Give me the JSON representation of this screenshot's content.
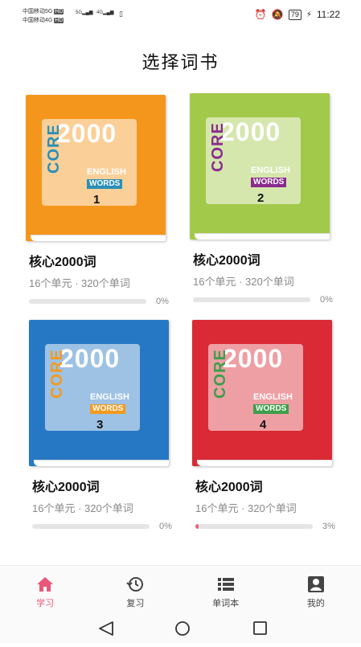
{
  "status_bar": {
    "carrier_line1": "中国移动5G",
    "carrier_line1_badge": "HD",
    "carrier_line2": "中国移动4G",
    "carrier_line2_badge": "HD",
    "net1": "5G",
    "net2": "4G",
    "battery": "79",
    "time": "11:22"
  },
  "title": "选择词书",
  "books": [
    {
      "title": "核心2000词",
      "meta": "16个单元 · 320个单词",
      "progress": 0,
      "progress_text": "0%",
      "cover_number": "2000",
      "cover_core": "CORE",
      "cover_english": "ENGLISH",
      "cover_words": "WORDS",
      "volume": "1",
      "color": "#f5961c",
      "core_color": "#2a8fb5",
      "words_bg": "#2a8fb5"
    },
    {
      "title": "核心2000词",
      "meta": "16个单元 · 320个单词",
      "progress": 0,
      "progress_text": "0%",
      "cover_number": "2000",
      "cover_core": "CORE",
      "cover_english": "ENGLISH",
      "cover_words": "WORDS",
      "volume": "2",
      "color": "#a3c94a",
      "core_color": "#8a2b8f",
      "words_bg": "#8a2b8f"
    },
    {
      "title": "核心2000词",
      "meta": "16个单元 · 320个单词",
      "progress": 0,
      "progress_text": "0%",
      "cover_number": "2000",
      "cover_core": "CORE",
      "cover_english": "ENGLISH",
      "cover_words": "WORDS",
      "volume": "3",
      "color": "#2778c4",
      "core_color": "#f39a1e",
      "words_bg": "#f39a1e"
    },
    {
      "title": "核心2000词",
      "meta": "16个单元 · 320个单词",
      "progress": 0.03,
      "progress_text": "3%",
      "cover_number": "2000",
      "cover_core": "CORE",
      "cover_english": "ENGLISH",
      "cover_words": "WORDS",
      "volume": "4",
      "color": "#d92a35",
      "core_color": "#3d9e4a",
      "words_bg": "#3d9e4a"
    }
  ],
  "nav": [
    {
      "label": "学习",
      "icon": "home-icon",
      "active": true
    },
    {
      "label": "复习",
      "icon": "history-icon",
      "active": false
    },
    {
      "label": "单词本",
      "icon": "list-icon",
      "active": false
    },
    {
      "label": "我的",
      "icon": "profile-icon",
      "active": false
    }
  ],
  "colors": {
    "accent": "#e8577a",
    "progress_fill": "#ec6175"
  }
}
